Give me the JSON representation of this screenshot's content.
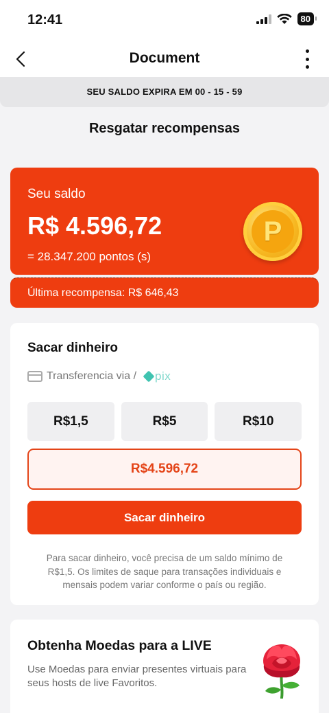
{
  "status_bar": {
    "time": "12:41",
    "battery": "80",
    "icons": [
      "cellular-signal-icon",
      "wifi-icon",
      "battery-icon"
    ]
  },
  "nav": {
    "title": "Document",
    "back_icon": "chevron-left-icon",
    "more_icon": "more-vertical-icon"
  },
  "expiry": {
    "label": "SEU SALDO EXPIRA EM",
    "countdown": "00 - 15 - 59"
  },
  "page_title": "Resgatar recompensas",
  "balance": {
    "label": "Seu saldo",
    "value": "R$ 4.596,72",
    "points": "= 28.347.200 pontos (s)",
    "coin_letter": "P",
    "last_reward": "Última recompensa: R$ 646,43",
    "accent_color": "#ee3d10"
  },
  "withdraw": {
    "title": "Sacar dinheiro",
    "transfer_label": "Transferencia via /",
    "pix_label": "pix",
    "amounts": [
      "R$1,5",
      "R$5",
      "R$10"
    ],
    "selected_amount": "R$4.596,72",
    "button_label": "Sacar dinheiro",
    "note": "Para sacar dinheiro, você precisa de um saldo mínimo de R$1,5. Os limites de saque para transações individuais e mensais podem variar conforme o país ou região."
  },
  "coins": {
    "title": "Obtenha Moedas para a LIVE",
    "description": "Use Moedas para enviar presentes virtuais para seus hosts de live Favoritos.",
    "image_icon": "rose-icon"
  }
}
